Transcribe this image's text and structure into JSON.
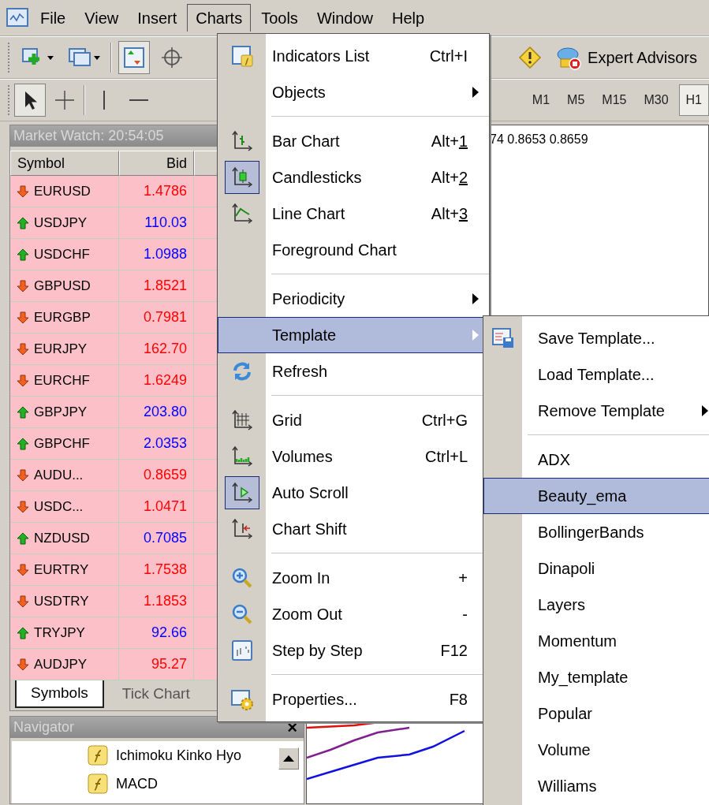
{
  "menubar": {
    "items": [
      {
        "label": "File",
        "selected": false
      },
      {
        "label": "View",
        "selected": false
      },
      {
        "label": "Insert",
        "selected": false
      },
      {
        "label": "Charts",
        "selected": true
      },
      {
        "label": "Tools",
        "selected": false
      },
      {
        "label": "Window",
        "selected": false
      },
      {
        "label": "Help",
        "selected": false
      }
    ]
  },
  "toolbar_1": {
    "buttons": [
      {
        "pressed": false
      },
      {
        "pressed": false
      },
      {
        "pressed": true
      },
      {
        "pressed": false
      },
      {
        "pressed": false
      }
    ],
    "expert_advisors": {
      "label": "Expert Advisors"
    }
  },
  "toolbar_2": {
    "tools": [
      {
        "pressed": true
      },
      {
        "pressed": false
      },
      {
        "pressed": false
      },
      {
        "pressed": false
      }
    ],
    "timeframes": [
      {
        "label": "M1",
        "selected": false
      },
      {
        "label": "M5",
        "selected": false
      },
      {
        "label": "M15",
        "selected": false
      },
      {
        "label": "M30",
        "selected": false
      },
      {
        "label": "H1",
        "selected": true
      }
    ]
  },
  "market_watch": {
    "title": "Market Watch: 20:54:05",
    "columns": [
      "Symbol",
      "Bid"
    ],
    "rows": [
      {
        "symbol": "EURUSD",
        "bid": "1.4786",
        "up": false
      },
      {
        "symbol": "USDJPY",
        "bid": "110.03",
        "up": true
      },
      {
        "symbol": "USDCHF",
        "bid": "1.0988",
        "up": true
      },
      {
        "symbol": "GBPUSD",
        "bid": "1.8521",
        "up": false
      },
      {
        "symbol": "EURGBP",
        "bid": "0.7981",
        "up": false
      },
      {
        "symbol": "EURJPY",
        "bid": "162.70",
        "up": false
      },
      {
        "symbol": "EURCHF",
        "bid": "1.6249",
        "up": false
      },
      {
        "symbol": "GBPJPY",
        "bid": "203.80",
        "up": true
      },
      {
        "symbol": "GBPCHF",
        "bid": "2.0353",
        "up": true
      },
      {
        "symbol": "AUDU...",
        "bid": "0.8659",
        "up": false
      },
      {
        "symbol": "USDC...",
        "bid": "1.0471",
        "up": false
      },
      {
        "symbol": "NZDUSD",
        "bid": "0.7085",
        "up": true
      },
      {
        "symbol": "EURTRY",
        "bid": "1.7538",
        "up": false
      },
      {
        "symbol": "USDTRY",
        "bid": "1.1853",
        "up": false
      },
      {
        "symbol": "TRYJPY",
        "bid": "92.66",
        "up": true
      },
      {
        "symbol": "AUDJPY",
        "bid": "95.27",
        "up": false
      }
    ],
    "tabs": [
      {
        "label": "Symbols",
        "selected": true
      },
      {
        "label": "Tick Chart",
        "selected": false
      }
    ]
  },
  "navigator": {
    "title": "Navigator",
    "close": "×",
    "items": [
      {
        "label": "Ichimoku Kinko Hyo"
      },
      {
        "label": "MACD"
      }
    ]
  },
  "chart": {
    "header": "74 0.8653 0.8659"
  },
  "charts_menu": {
    "items": [
      {
        "kind": "item",
        "label": "Indicators List",
        "shortcut": "Ctrl+I",
        "checked": false,
        "selected": false
      },
      {
        "kind": "item",
        "label": "Objects",
        "submenu": true,
        "checked": false,
        "selected": false
      },
      {
        "kind": "separator"
      },
      {
        "kind": "item",
        "label": "Bar Chart",
        "shortcut": "Alt+1",
        "underline_last": true,
        "checked": false,
        "selected": false
      },
      {
        "kind": "item",
        "label": "Candlesticks",
        "shortcut": "Alt+2",
        "underline_last": true,
        "checked": true,
        "selected": false
      },
      {
        "kind": "item",
        "label": "Line Chart",
        "shortcut": "Alt+3",
        "underline_last": true,
        "checked": false,
        "selected": false
      },
      {
        "kind": "item",
        "label": "Foreground Chart",
        "checked": false,
        "selected": false
      },
      {
        "kind": "separator"
      },
      {
        "kind": "item",
        "label": "Periodicity",
        "submenu": true,
        "checked": false,
        "selected": false
      },
      {
        "kind": "item",
        "label": "Template",
        "submenu": true,
        "checked": false,
        "selected": true
      },
      {
        "kind": "item",
        "label": "Refresh",
        "checked": false,
        "selected": false
      },
      {
        "kind": "separator"
      },
      {
        "kind": "item",
        "label": "Grid",
        "shortcut": "Ctrl+G",
        "checked": false,
        "selected": false
      },
      {
        "kind": "item",
        "label": "Volumes",
        "shortcut": "Ctrl+L",
        "checked": false,
        "selected": false
      },
      {
        "kind": "item",
        "label": "Auto Scroll",
        "checked": true,
        "selected": false
      },
      {
        "kind": "item",
        "label": "Chart Shift",
        "checked": false,
        "selected": false
      },
      {
        "kind": "separator"
      },
      {
        "kind": "item",
        "label": "Zoom In",
        "shortcut": "+",
        "checked": false,
        "selected": false
      },
      {
        "kind": "item",
        "label": "Zoom Out",
        "shortcut": "-",
        "checked": false,
        "selected": false
      },
      {
        "kind": "item",
        "label": "Step by Step",
        "shortcut": "F12",
        "checked": false,
        "selected": false
      },
      {
        "kind": "separator"
      },
      {
        "kind": "item",
        "label": "Properties...",
        "shortcut": "F8",
        "checked": false,
        "selected": false
      }
    ]
  },
  "template_menu": {
    "items": [
      {
        "kind": "item",
        "label": "Save Template...",
        "selected": false
      },
      {
        "kind": "item",
        "label": "Load Template...",
        "selected": false
      },
      {
        "kind": "item",
        "label": "Remove Template",
        "submenu": true,
        "selected": false
      },
      {
        "kind": "separator"
      },
      {
        "kind": "item",
        "label": "ADX",
        "selected": false
      },
      {
        "kind": "item",
        "label": "Beauty_ema",
        "selected": true
      },
      {
        "kind": "item",
        "label": "BollingerBands",
        "selected": false
      },
      {
        "kind": "item",
        "label": "Dinapoli",
        "selected": false
      },
      {
        "kind": "item",
        "label": "Layers",
        "selected": false
      },
      {
        "kind": "item",
        "label": "Momentum",
        "selected": false
      },
      {
        "kind": "item",
        "label": "My_template",
        "selected": false
      },
      {
        "kind": "item",
        "label": "Popular",
        "selected": false
      },
      {
        "kind": "item",
        "label": "Volume",
        "selected": false
      },
      {
        "kind": "item",
        "label": "Williams",
        "selected": false
      }
    ]
  }
}
